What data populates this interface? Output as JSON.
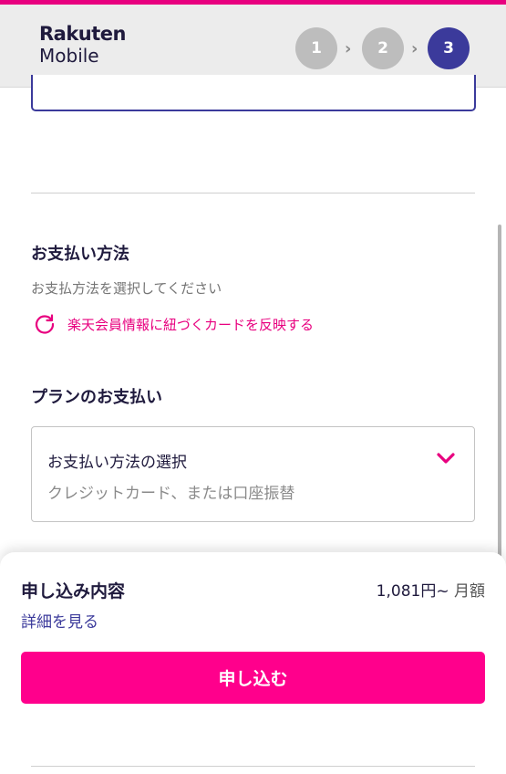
{
  "header": {
    "logo_line1": "Rakuten",
    "logo_line2": "Mobile",
    "steps": [
      {
        "label": "1",
        "state": "done"
      },
      {
        "label": "2",
        "state": "done"
      },
      {
        "label": "3",
        "state": "current"
      }
    ],
    "step_separator": "›"
  },
  "payment": {
    "title": "お支払い方法",
    "instruction": "お支払方法を選択してください",
    "reflect_link": "楽天会員情報に紐づくカードを反映する",
    "reflect_icon": "refresh-icon"
  },
  "plan_payment": {
    "title": "プランのお支払い",
    "select_label": "お支払い方法の選択",
    "select_placeholder": "クレジットカード、または口座振替",
    "select_icon": "chevron-down-icon"
  },
  "summary": {
    "title": "申し込み内容",
    "price": "1,081円~",
    "price_unit": "月額",
    "detail_link": "詳細を見る",
    "apply_button": "申し込む"
  },
  "colors": {
    "accent": "#e8007f",
    "button": "#ff008c",
    "primary": "#3b3a9b",
    "step_inactive": "#bdbdbd"
  }
}
